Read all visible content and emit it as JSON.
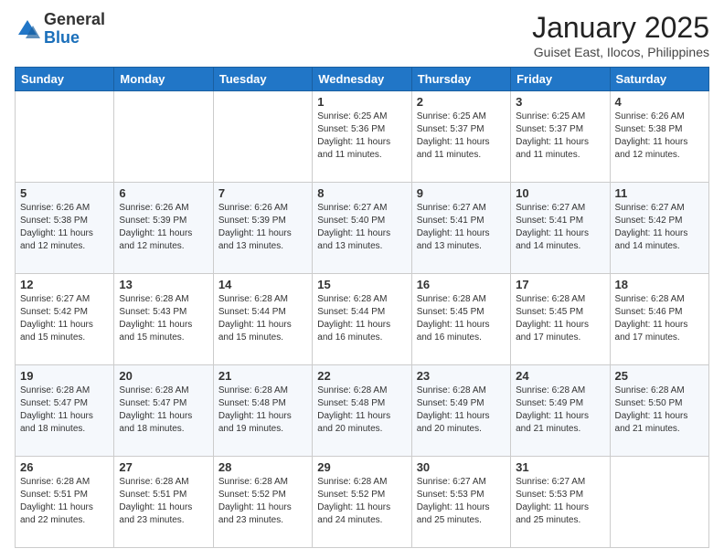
{
  "header": {
    "logo_general": "General",
    "logo_blue": "Blue",
    "month_year": "January 2025",
    "location": "Guiset East, Ilocos, Philippines"
  },
  "days_of_week": [
    "Sunday",
    "Monday",
    "Tuesday",
    "Wednesday",
    "Thursday",
    "Friday",
    "Saturday"
  ],
  "weeks": [
    [
      {
        "day": "",
        "sunrise": "",
        "sunset": "",
        "daylight": ""
      },
      {
        "day": "",
        "sunrise": "",
        "sunset": "",
        "daylight": ""
      },
      {
        "day": "",
        "sunrise": "",
        "sunset": "",
        "daylight": ""
      },
      {
        "day": "1",
        "sunrise": "Sunrise: 6:25 AM",
        "sunset": "Sunset: 5:36 PM",
        "daylight": "Daylight: 11 hours and 11 minutes."
      },
      {
        "day": "2",
        "sunrise": "Sunrise: 6:25 AM",
        "sunset": "Sunset: 5:37 PM",
        "daylight": "Daylight: 11 hours and 11 minutes."
      },
      {
        "day": "3",
        "sunrise": "Sunrise: 6:25 AM",
        "sunset": "Sunset: 5:37 PM",
        "daylight": "Daylight: 11 hours and 11 minutes."
      },
      {
        "day": "4",
        "sunrise": "Sunrise: 6:26 AM",
        "sunset": "Sunset: 5:38 PM",
        "daylight": "Daylight: 11 hours and 12 minutes."
      }
    ],
    [
      {
        "day": "5",
        "sunrise": "Sunrise: 6:26 AM",
        "sunset": "Sunset: 5:38 PM",
        "daylight": "Daylight: 11 hours and 12 minutes."
      },
      {
        "day": "6",
        "sunrise": "Sunrise: 6:26 AM",
        "sunset": "Sunset: 5:39 PM",
        "daylight": "Daylight: 11 hours and 12 minutes."
      },
      {
        "day": "7",
        "sunrise": "Sunrise: 6:26 AM",
        "sunset": "Sunset: 5:39 PM",
        "daylight": "Daylight: 11 hours and 13 minutes."
      },
      {
        "day": "8",
        "sunrise": "Sunrise: 6:27 AM",
        "sunset": "Sunset: 5:40 PM",
        "daylight": "Daylight: 11 hours and 13 minutes."
      },
      {
        "day": "9",
        "sunrise": "Sunrise: 6:27 AM",
        "sunset": "Sunset: 5:41 PM",
        "daylight": "Daylight: 11 hours and 13 minutes."
      },
      {
        "day": "10",
        "sunrise": "Sunrise: 6:27 AM",
        "sunset": "Sunset: 5:41 PM",
        "daylight": "Daylight: 11 hours and 14 minutes."
      },
      {
        "day": "11",
        "sunrise": "Sunrise: 6:27 AM",
        "sunset": "Sunset: 5:42 PM",
        "daylight": "Daylight: 11 hours and 14 minutes."
      }
    ],
    [
      {
        "day": "12",
        "sunrise": "Sunrise: 6:27 AM",
        "sunset": "Sunset: 5:42 PM",
        "daylight": "Daylight: 11 hours and 15 minutes."
      },
      {
        "day": "13",
        "sunrise": "Sunrise: 6:28 AM",
        "sunset": "Sunset: 5:43 PM",
        "daylight": "Daylight: 11 hours and 15 minutes."
      },
      {
        "day": "14",
        "sunrise": "Sunrise: 6:28 AM",
        "sunset": "Sunset: 5:44 PM",
        "daylight": "Daylight: 11 hours and 15 minutes."
      },
      {
        "day": "15",
        "sunrise": "Sunrise: 6:28 AM",
        "sunset": "Sunset: 5:44 PM",
        "daylight": "Daylight: 11 hours and 16 minutes."
      },
      {
        "day": "16",
        "sunrise": "Sunrise: 6:28 AM",
        "sunset": "Sunset: 5:45 PM",
        "daylight": "Daylight: 11 hours and 16 minutes."
      },
      {
        "day": "17",
        "sunrise": "Sunrise: 6:28 AM",
        "sunset": "Sunset: 5:45 PM",
        "daylight": "Daylight: 11 hours and 17 minutes."
      },
      {
        "day": "18",
        "sunrise": "Sunrise: 6:28 AM",
        "sunset": "Sunset: 5:46 PM",
        "daylight": "Daylight: 11 hours and 17 minutes."
      }
    ],
    [
      {
        "day": "19",
        "sunrise": "Sunrise: 6:28 AM",
        "sunset": "Sunset: 5:47 PM",
        "daylight": "Daylight: 11 hours and 18 minutes."
      },
      {
        "day": "20",
        "sunrise": "Sunrise: 6:28 AM",
        "sunset": "Sunset: 5:47 PM",
        "daylight": "Daylight: 11 hours and 18 minutes."
      },
      {
        "day": "21",
        "sunrise": "Sunrise: 6:28 AM",
        "sunset": "Sunset: 5:48 PM",
        "daylight": "Daylight: 11 hours and 19 minutes."
      },
      {
        "day": "22",
        "sunrise": "Sunrise: 6:28 AM",
        "sunset": "Sunset: 5:48 PM",
        "daylight": "Daylight: 11 hours and 20 minutes."
      },
      {
        "day": "23",
        "sunrise": "Sunrise: 6:28 AM",
        "sunset": "Sunset: 5:49 PM",
        "daylight": "Daylight: 11 hours and 20 minutes."
      },
      {
        "day": "24",
        "sunrise": "Sunrise: 6:28 AM",
        "sunset": "Sunset: 5:49 PM",
        "daylight": "Daylight: 11 hours and 21 minutes."
      },
      {
        "day": "25",
        "sunrise": "Sunrise: 6:28 AM",
        "sunset": "Sunset: 5:50 PM",
        "daylight": "Daylight: 11 hours and 21 minutes."
      }
    ],
    [
      {
        "day": "26",
        "sunrise": "Sunrise: 6:28 AM",
        "sunset": "Sunset: 5:51 PM",
        "daylight": "Daylight: 11 hours and 22 minutes."
      },
      {
        "day": "27",
        "sunrise": "Sunrise: 6:28 AM",
        "sunset": "Sunset: 5:51 PM",
        "daylight": "Daylight: 11 hours and 23 minutes."
      },
      {
        "day": "28",
        "sunrise": "Sunrise: 6:28 AM",
        "sunset": "Sunset: 5:52 PM",
        "daylight": "Daylight: 11 hours and 23 minutes."
      },
      {
        "day": "29",
        "sunrise": "Sunrise: 6:28 AM",
        "sunset": "Sunset: 5:52 PM",
        "daylight": "Daylight: 11 hours and 24 minutes."
      },
      {
        "day": "30",
        "sunrise": "Sunrise: 6:27 AM",
        "sunset": "Sunset: 5:53 PM",
        "daylight": "Daylight: 11 hours and 25 minutes."
      },
      {
        "day": "31",
        "sunrise": "Sunrise: 6:27 AM",
        "sunset": "Sunset: 5:53 PM",
        "daylight": "Daylight: 11 hours and 25 minutes."
      },
      {
        "day": "",
        "sunrise": "",
        "sunset": "",
        "daylight": ""
      }
    ]
  ]
}
